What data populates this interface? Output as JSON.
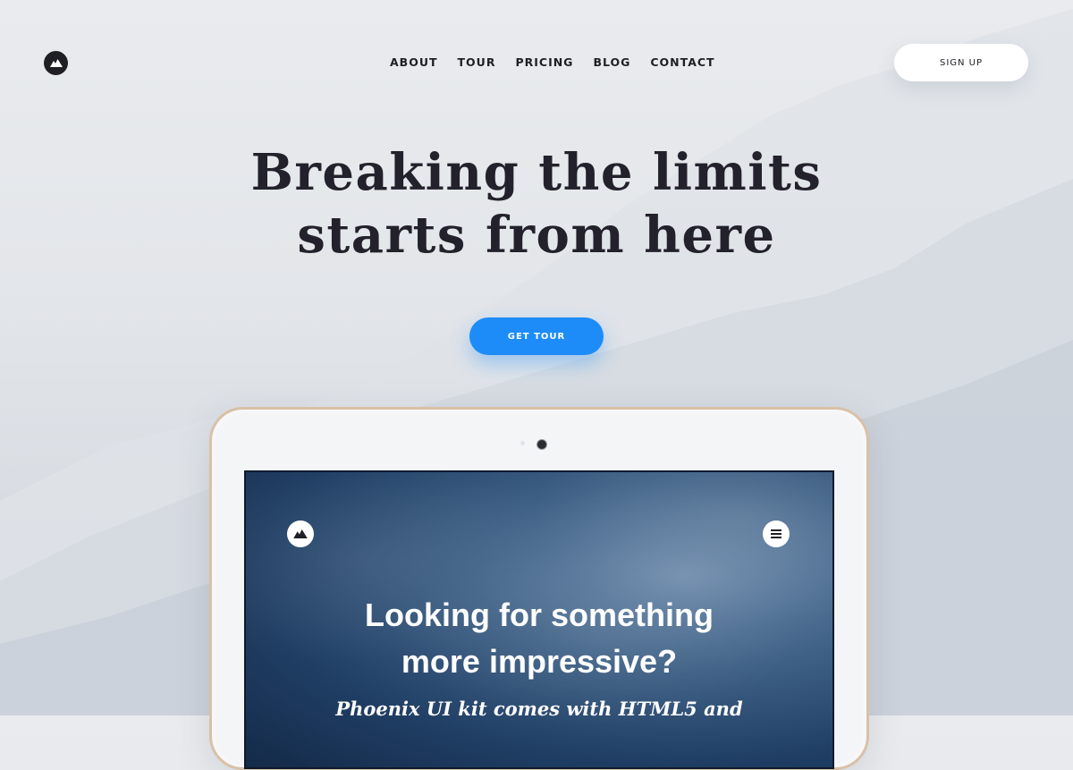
{
  "header": {
    "logo_icon": "mountain-logo-icon",
    "nav": [
      "ABOUT",
      "TOUR",
      "PRICING",
      "BLOG",
      "CONTACT"
    ],
    "signup_label": "SIGN UP"
  },
  "hero": {
    "title_line1": "Breaking the limits",
    "title_line2": "starts from here",
    "cta_label": "GET TOUR"
  },
  "tablet_screen": {
    "logo_icon": "mountain-logo-icon",
    "menu_icon": "hamburger-menu-icon",
    "title_line1": "Looking for something",
    "title_line2": "more impressive?",
    "subtitle": "Phoenix UI kit comes with HTML5 and"
  },
  "colors": {
    "accent": "#1d8cf8",
    "text_dark": "#23212c",
    "button_white": "#ffffff",
    "tablet_frame": "#d9c1a6",
    "screen_sky": "#1f3d63"
  }
}
